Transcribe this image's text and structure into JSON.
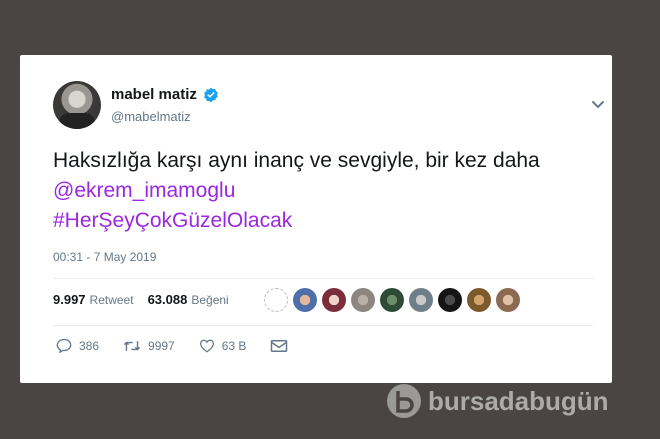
{
  "user": {
    "display_name": "mabel matiz",
    "handle": "@mabelmatiz",
    "verified": true
  },
  "tweet": {
    "text_plain": "Haksızlığa karşı aynı inanç ve sevgiyle, bir kez daha ",
    "mention": "@ekrem_imamoglu",
    "hashtag": "#HerŞeyÇokGüzelOlacak",
    "timestamp": "00:31 - 7 May 2019"
  },
  "stats": {
    "retweets_count": "9.997",
    "retweets_label": "Retweet",
    "likes_count": "63.088",
    "likes_label": "Beğeni"
  },
  "actions": {
    "replies": "386",
    "retweets": "9997",
    "likes": "63 B"
  },
  "watermark": "bursadabugün",
  "colors": {
    "link": "#9c27e0",
    "verified": "#1da1f2",
    "background": "#4a4444"
  }
}
